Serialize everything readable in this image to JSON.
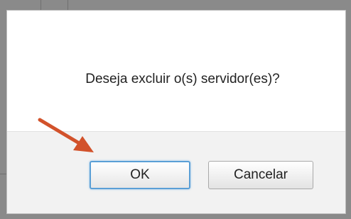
{
  "dialog": {
    "message": "Deseja excluir o(s) servidor(es)?",
    "ok_label": "OK",
    "cancel_label": "Cancelar"
  },
  "colors": {
    "annotation_arrow": "#d2522b",
    "focus_outline": "#5a9fd6",
    "button_bar_bg": "#f2f2f2"
  },
  "icons": {
    "annotation": "arrow-pointer-icon"
  }
}
